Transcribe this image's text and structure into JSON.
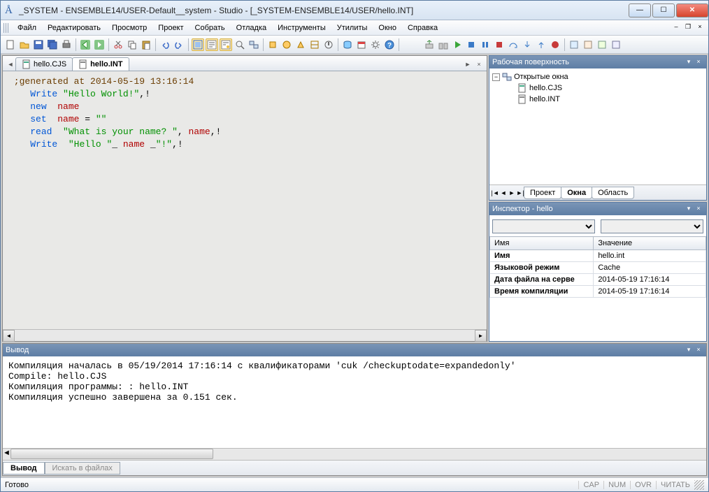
{
  "window": {
    "title": "_SYSTEM - ENSEMBLE14/USER-Default__system - Studio - [_SYSTEM-ENSEMBLE14/USER/hello.INT]"
  },
  "menu": [
    "Файл",
    "Редактировать",
    "Просмотр",
    "Проект",
    "Собрать",
    "Отладка",
    "Инструменты",
    "Утилиты",
    "Окно",
    "Справка"
  ],
  "tabs": {
    "left_nav": "◄",
    "files": [
      {
        "label": "hello.CJS",
        "active": false
      },
      {
        "label": "hello.INT",
        "active": true
      }
    ],
    "right_nav": "►",
    "close": "×"
  },
  "code": {
    "comment": " ;generated at 2014-05-19 13:16:14",
    "lines": [
      {
        "indent": "    ",
        "parts": [
          [
            "kw",
            "Write"
          ],
          [
            "",
            ""
          ],
          [
            "str",
            "\"Hello World!\""
          ],
          [
            "",
            ","
          ],
          [
            "",
            "!"
          ]
        ]
      },
      {
        "indent": "    ",
        "parts": [
          [
            "kw",
            "new"
          ],
          [
            "",
            " "
          ],
          [
            "var",
            "name"
          ]
        ]
      },
      {
        "indent": "    ",
        "parts": [
          [
            "kw",
            "set"
          ],
          [
            "",
            " "
          ],
          [
            "var",
            "name"
          ],
          [
            "",
            " = "
          ],
          [
            "str",
            "\"\""
          ]
        ]
      },
      {
        "indent": "    ",
        "parts": [
          [
            "kw",
            "read"
          ],
          [
            "",
            " "
          ],
          [
            "str",
            "\"What is your name? \""
          ],
          [
            "",
            ", "
          ],
          [
            "var",
            "name"
          ],
          [
            "",
            ",!"
          ]
        ]
      },
      {
        "indent": "    ",
        "parts": [
          [
            "kw",
            "Write"
          ],
          [
            "",
            " "
          ],
          [
            "str",
            "\"Hello \""
          ],
          [
            "",
            "_ "
          ],
          [
            "var",
            "name"
          ],
          [
            "",
            " _"
          ],
          [
            "str",
            "\"!\""
          ],
          [
            "",
            ",!"
          ]
        ]
      }
    ]
  },
  "workspace": {
    "title": "Рабочая поверхность",
    "root": "Открытые окна",
    "items": [
      "hello.CJS",
      "hello.INT"
    ],
    "tabs": [
      "Проект",
      "Окна",
      "Область"
    ],
    "active_tab": 1
  },
  "inspector": {
    "title": "Инспектор - hello",
    "columns": [
      "Имя",
      "Значение"
    ],
    "rows": [
      {
        "k": "Имя",
        "v": "hello.int"
      },
      {
        "k": "Языковой режим",
        "v": "Cache"
      },
      {
        "k": "Дата файла на серве",
        "v": "2014-05-19 17:16:14"
      },
      {
        "k": "Время компиляции",
        "v": "2014-05-19 17:16:14"
      }
    ]
  },
  "output": {
    "title": "Вывод",
    "text": "Компиляция началась в 05/19/2014 17:16:14 с квалификаторами 'cuk /checkuptodate=expandedonly'\nCompile: hello.CJS\nКомпиляция программы: : hello.INT\nКомпиляция успешно завершена за 0.151 сек.",
    "tabs": [
      "Вывод",
      "Искать в файлах"
    ]
  },
  "status": {
    "text": "Готово",
    "indicators": [
      "CAP",
      "NUM",
      "OVR",
      "ЧИТАТЬ"
    ]
  }
}
